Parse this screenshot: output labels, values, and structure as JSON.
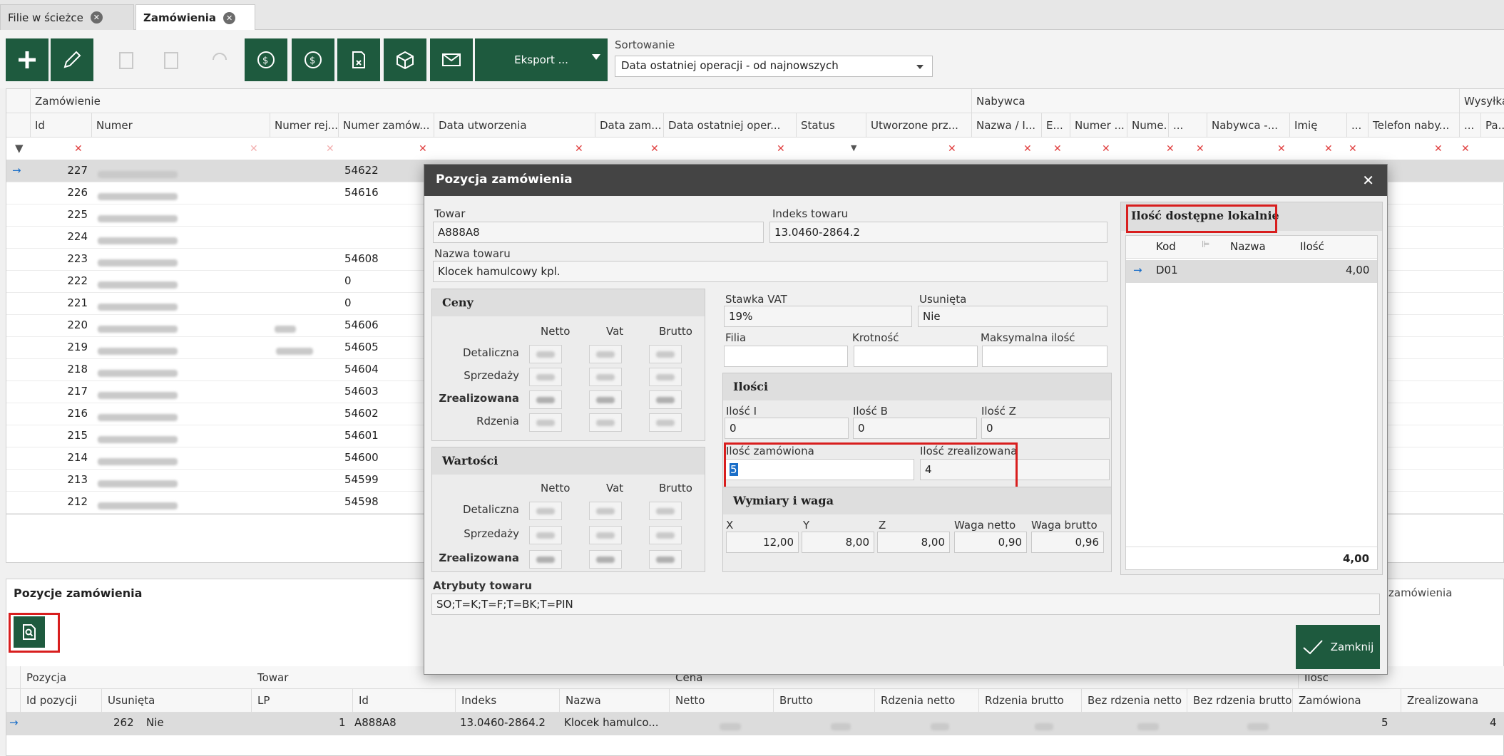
{
  "tabs": [
    {
      "label": "Filie w ścieżce"
    },
    {
      "label": "Zamówienia"
    }
  ],
  "toolbar": {
    "export_label": "Eksport ...",
    "sort_label": "Sortowanie",
    "sort_value": "Data ostatniej operacji - od najnowszych",
    "icons": [
      "plus-icon",
      "pencil-icon",
      "copy-icon",
      "copy2-icon",
      "refresh-icon",
      "money-list-icon",
      "money-icon",
      "doc-x-icon",
      "box-icon",
      "mail-icon"
    ]
  },
  "grid": {
    "bands": {
      "order": "Zamówienie",
      "buyer": "Nabywca",
      "shipping": "Wysyłka"
    },
    "columns": [
      "Id",
      "Numer",
      "Numer rej...",
      "Numer zamów...",
      "Data utworzenia",
      "Data zam...",
      "Data ostatniej oper...",
      "Status",
      "Utworzone prz...",
      "Nazwa / I...",
      "E...",
      "Numer ...",
      "Nume...",
      "...",
      "Nabywca -...",
      "Imię",
      "...",
      "Telefon naby...",
      "...",
      "Pa..."
    ],
    "rows": [
      {
        "id": "227",
        "nr_zam": "54622"
      },
      {
        "id": "226",
        "nr_zam": "54616"
      },
      {
        "id": "225",
        "nr_zam": ""
      },
      {
        "id": "224",
        "nr_zam": ""
      },
      {
        "id": "223",
        "nr_zam": "54608"
      },
      {
        "id": "222",
        "nr_zam": "0"
      },
      {
        "id": "221",
        "nr_zam": "0"
      },
      {
        "id": "220",
        "nr_zam": "54606"
      },
      {
        "id": "219",
        "nr_zam": "54605"
      },
      {
        "id": "218",
        "nr_zam": "54604"
      },
      {
        "id": "217",
        "nr_zam": "54603"
      },
      {
        "id": "216",
        "nr_zam": "54602"
      },
      {
        "id": "215",
        "nr_zam": "54601"
      },
      {
        "id": "214",
        "nr_zam": "54600"
      },
      {
        "id": "213",
        "nr_zam": "54599"
      },
      {
        "id": "212",
        "nr_zam": "54598"
      }
    ]
  },
  "lower": {
    "title": "Pozycje zamówienia",
    "title_right": "zamówienia",
    "bands": {
      "pos": "Pozycja",
      "item": "Towar",
      "price": "Cena",
      "qty": "Ilość"
    },
    "columns": [
      "Id pozycji",
      "Usunięta",
      "LP",
      "Id",
      "Indeks",
      "Nazwa",
      "Netto",
      "Brutto",
      "Rdzenia netto",
      "Rdzenia brutto",
      "Bez rdzenia netto",
      "Bez rdzenia brutto",
      "Zamówiona",
      "Zrealizowana"
    ],
    "row": {
      "id_pozycji": "262",
      "usunieta": "Nie",
      "lp": "1",
      "id": "A888A8",
      "indeks": "13.0460-2864.2",
      "nazwa": "Klocek hamulco...",
      "zamowiona": "5",
      "zrealizowana": "4"
    }
  },
  "dialog": {
    "title": "Pozycja zamówienia",
    "towar_label": "Towar",
    "towar_value": "A888A8",
    "indeks_label": "Indeks towaru",
    "indeks_value": "13.0460-2864.2",
    "nazwa_label": "Nazwa towaru",
    "nazwa_value": "Klocek hamulcowy kpl.",
    "ceny": {
      "title": "Ceny",
      "cols": [
        "Netto",
        "Vat",
        "Brutto"
      ],
      "rows": [
        "Detaliczna",
        "Sprzedaży",
        "Zrealizowana",
        "Rdzenia"
      ]
    },
    "wartosci": {
      "title": "Wartości",
      "cols": [
        "Netto",
        "Vat",
        "Brutto"
      ],
      "rows": [
        "Detaliczna",
        "Sprzedaży",
        "Zrealizowana"
      ]
    },
    "vat_label": "Stawka VAT",
    "vat_value": "19%",
    "usunieta_label": "Usunięta",
    "usunieta_value": "Nie",
    "filia_label": "Filia",
    "krotnosc_label": "Krotność",
    "maks_label": "Maksymalna ilość",
    "ilosci": {
      "title": "Ilości",
      "i_label": "Ilość I",
      "i_value": "0",
      "b_label": "Ilość B",
      "b_value": "0",
      "z_label": "Ilość Z",
      "z_value": "0",
      "zam_label": "Ilość zamówiona",
      "zam_value": "5",
      "zreal_label": "Ilość zrealizowana",
      "zreal_value": "4"
    },
    "wymiary": {
      "title": "Wymiary i waga",
      "x_label": "X",
      "x_value": "12,00",
      "y_label": "Y",
      "y_value": "8,00",
      "z_label": "Z",
      "z_value": "8,00",
      "netto_label": "Waga netto",
      "netto_value": "0,90",
      "brutto_label": "Waga brutto",
      "brutto_value": "0,96"
    },
    "atrybuty_label": "Atrybuty towaru",
    "atrybuty_value": "SO;T=K;T=F;T=BK;T=PIN",
    "lokalnie": {
      "title": "Ilość dostępne lokalnie",
      "cols": [
        "Kod",
        "Nazwa",
        "Ilość"
      ],
      "row": {
        "kod": "D01",
        "ilosc": "4,00"
      },
      "total": "4,00"
    },
    "close_label": "Zamknij"
  }
}
